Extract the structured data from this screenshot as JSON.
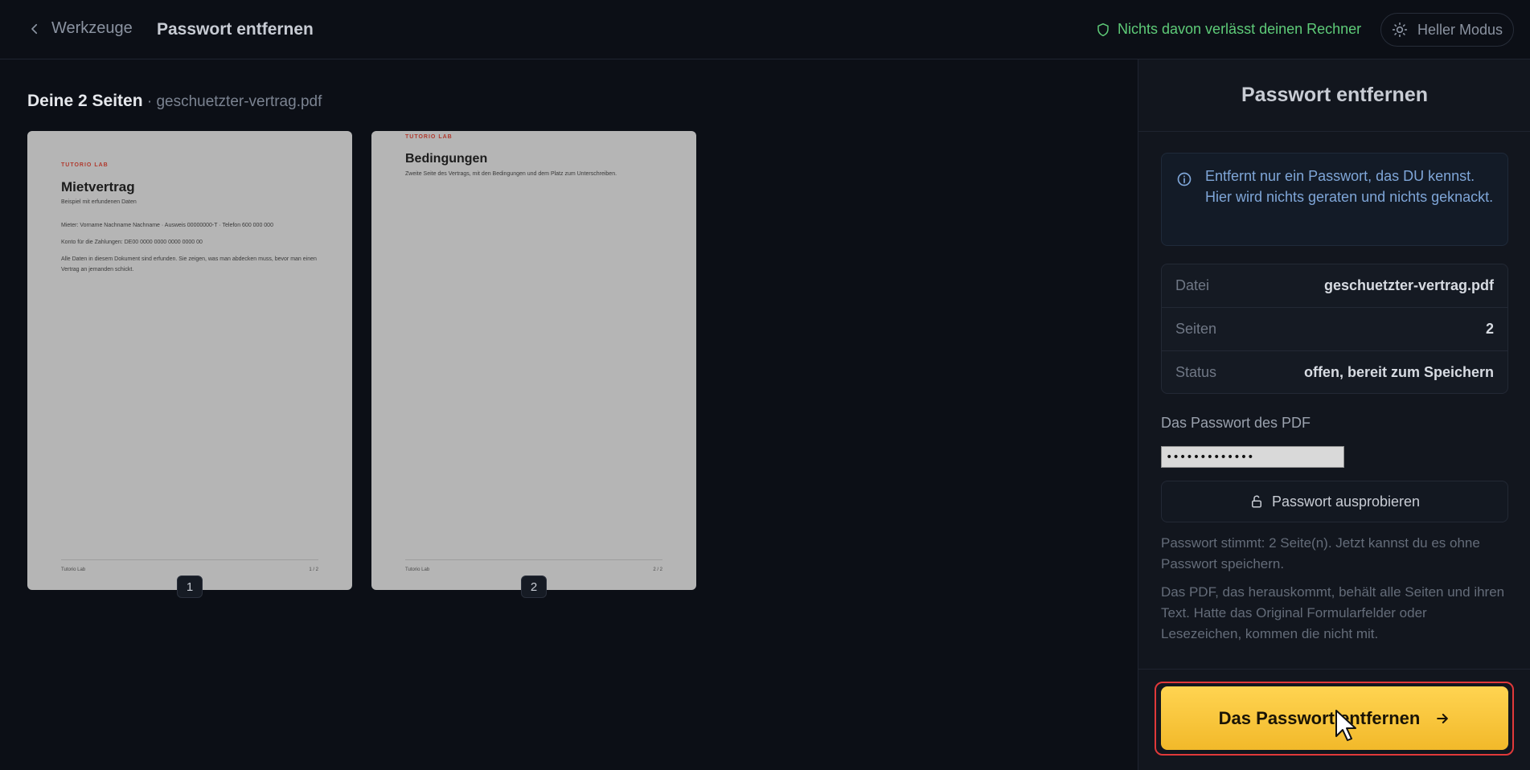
{
  "header": {
    "back_label": "Werkzeuge",
    "title": "Passwort entfernen",
    "privacy_text": "Nichts davon verlässt deinen Rechner",
    "mode_label": "Heller Modus"
  },
  "main": {
    "heading_strong": "Deine 2 Seiten",
    "heading_file": " · geschuetzter-vertrag.pdf",
    "pages": [
      {
        "number": "1",
        "brand": "TUTORIO LAB",
        "heading": "Mietvertrag",
        "subtitle": "Beispiel mit erfundenen Daten",
        "line1": "Mieter: Vorname Nachname Nachname · Ausweis 00000000-T · Telefon 600 000 000",
        "line2": "Konto für die Zahlungen: DE00 0000 0000 0000 0000 00",
        "line3": "Alle Daten in diesem Dokument sind erfunden. Sie zeigen, was man abdecken muss, bevor man einen Vertrag an jemanden schickt.",
        "footer_left": "Tutorio Lab",
        "footer_right": "1 / 2"
      },
      {
        "number": "2",
        "brand": "TUTORIO LAB",
        "heading": "Bedingungen",
        "line1": "Zweite Seite des Vertrags, mit den Bedingungen und dem Platz zum Unterschreiben.",
        "footer_left": "Tutorio Lab",
        "footer_right": "2 / 2"
      }
    ]
  },
  "sidebar": {
    "title": "Passwort entfernen",
    "info": "Entfernt nur ein Passwort, das DU kennst. Hier wird nichts geraten und nichts geknackt.",
    "meta": [
      {
        "key": "Datei",
        "value": "geschuetzter-vertrag.pdf"
      },
      {
        "key": "Seiten",
        "value": "2"
      },
      {
        "key": "Status",
        "value": "offen, bereit zum Speichern"
      }
    ],
    "password_label": "Das Passwort des PDF",
    "password_value": "•••••••••••••",
    "try_button": "Passwort ausprobieren",
    "note1": "Passwort stimmt: 2 Seite(n). Jetzt kannst du es ohne Passwort speichern.",
    "note2": "Das PDF, das herauskommt, behält alle Seiten und ihren Text. Hatte das Original Formularfelder oder Lesezeichen, kommen die nicht mit.",
    "cta": "Das Passwort entfernen"
  },
  "colors": {
    "background": "#0c0f16",
    "accent": "#f7c63b",
    "success": "#5ecb78",
    "info": "#7fa6d8",
    "focus_ring": "#e0393a"
  }
}
